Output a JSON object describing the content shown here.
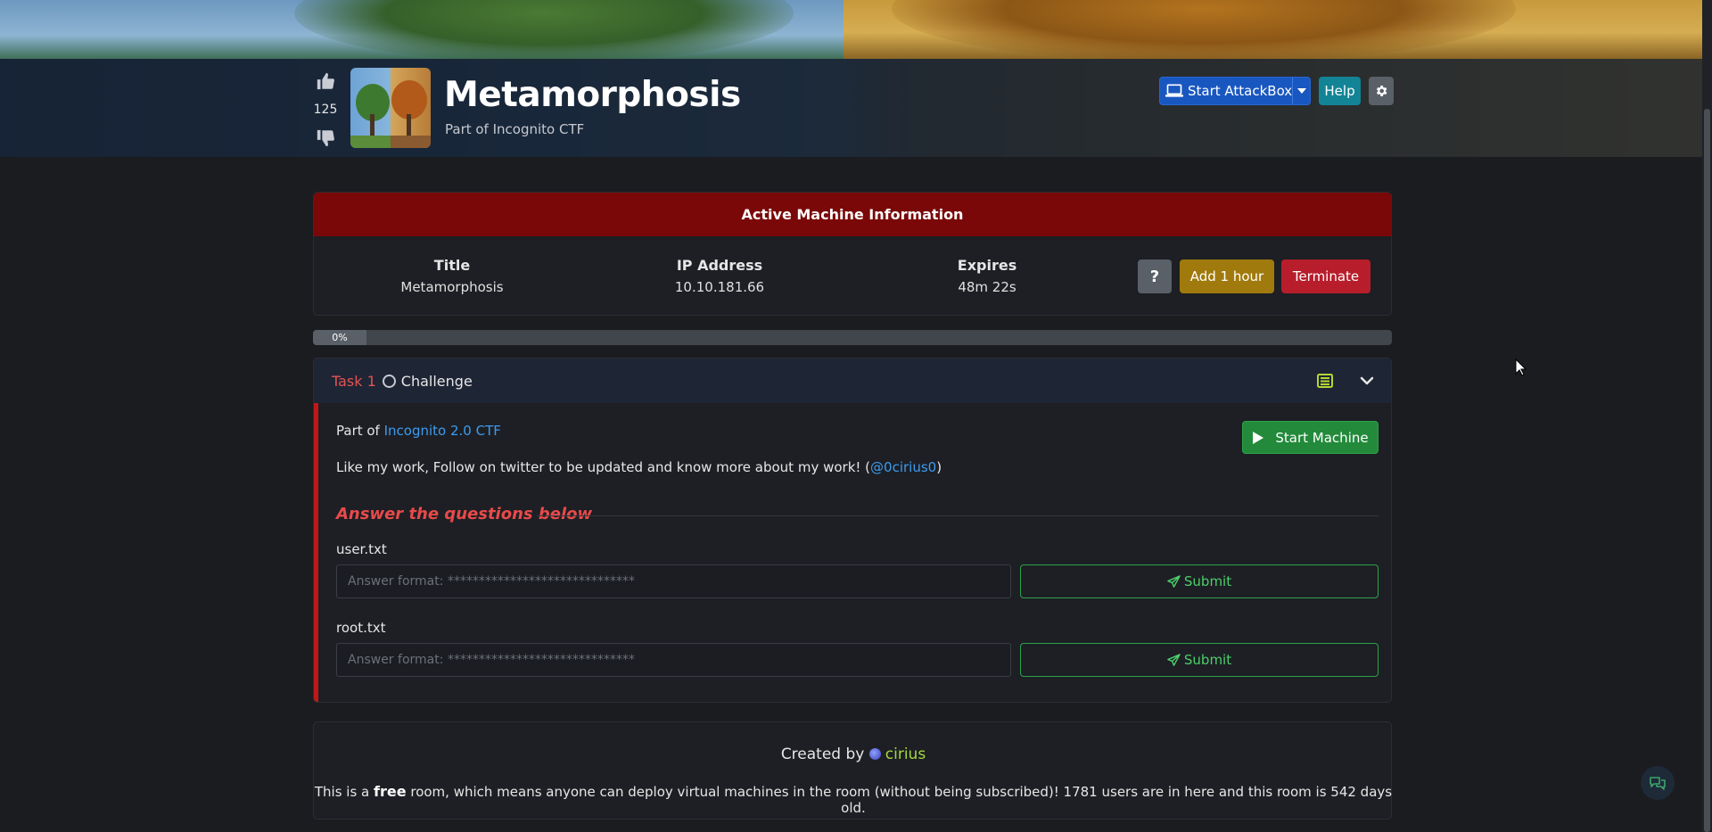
{
  "header": {
    "vote_count": "125",
    "title": "Metamorphosis",
    "subtitle": "Part of Incognito CTF",
    "attackbox_label": "Start AttackBox",
    "help_label": "Help"
  },
  "machine": {
    "heading": "Active Machine Information",
    "title_label": "Title",
    "title_value": "Metamorphosis",
    "ip_label": "IP Address",
    "ip_value": "10.10.181.66",
    "expires_label": "Expires",
    "expires_value": "48m 22s",
    "help_symbol": "?",
    "add_hour_label": "Add 1 hour",
    "terminate_label": "Terminate"
  },
  "progress": {
    "label": "0%",
    "value": 0
  },
  "task": {
    "number": "Task 1",
    "name": "Challenge",
    "part_prefix": "Part of ",
    "part_link": "Incognito 2.0 CTF",
    "like_text": "Like my work, Follow on twitter to be updated and know more about my work! (",
    "twitter_link": "@0cirius0",
    "like_close": ")",
    "start_machine_label": "Start Machine",
    "answer_heading": "Answer the questions below",
    "questions": [
      {
        "label": "user.txt",
        "placeholder": "Answer format: ******************************",
        "submit_label": "Submit"
      },
      {
        "label": "root.txt",
        "placeholder": "Answer format: ******************************",
        "submit_label": "Submit"
      }
    ]
  },
  "footer": {
    "created_by": "Created by",
    "author": "cirius",
    "free_prefix": "This is a ",
    "free_word": "free",
    "free_suffix": " room, which means anyone can deploy virtual machines in the room (without being subscribed)! 1781 users are in here and this room is 542 days old."
  },
  "colors": {
    "machine_header": "#7a0808",
    "accent_red": "#e35353",
    "submit_green": "#2da34a",
    "attackbox_blue": "#1957c0",
    "help_teal": "#138496",
    "add_hour_gold": "#a07a0c",
    "terminate_red": "#b81d2b",
    "author_green": "#a3d93b",
    "link_blue": "#3d9bf0"
  },
  "icons": {
    "like": "thumbs-up-icon",
    "dislike": "thumbs-down-icon",
    "attackbox": "laptop-icon",
    "settings": "gear-icon",
    "task_status": "circle-icon",
    "notes": "notes-icon",
    "collapse": "chevron-down-icon",
    "start_machine": "play-icon",
    "submit": "paper-plane-icon"
  }
}
